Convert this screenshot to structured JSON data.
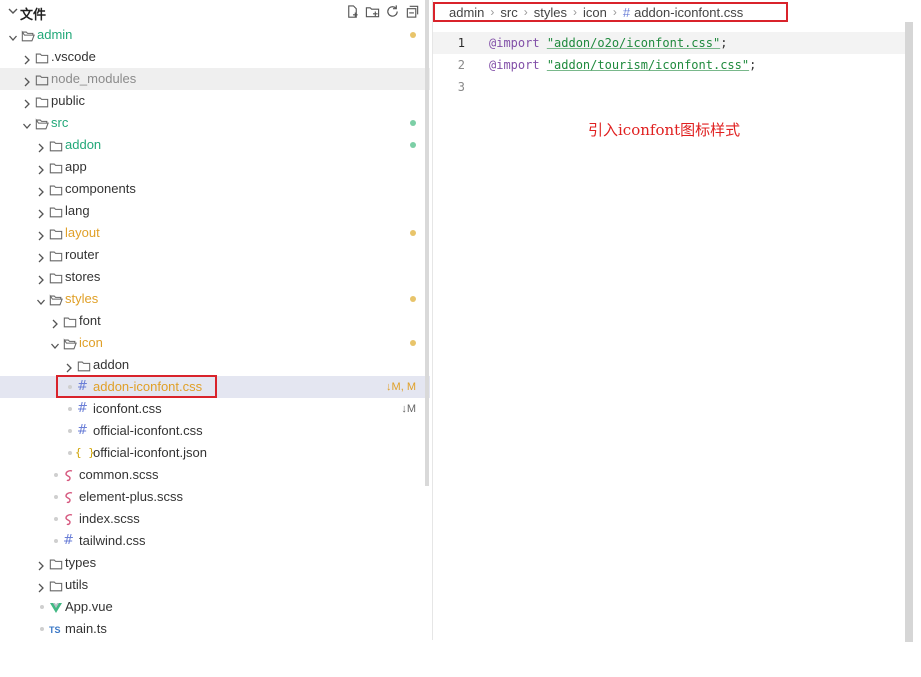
{
  "explorer": {
    "title": "文件",
    "tree": [
      {
        "id": "admin",
        "label": "admin",
        "icon": "folder-open",
        "chev": "down",
        "depth": 0,
        "color": "green",
        "dot": "#e8c46a"
      },
      {
        "id": "vscode",
        "label": ".vscode",
        "icon": "folder",
        "chev": "right",
        "depth": 1
      },
      {
        "id": "node_modules",
        "label": "node_modules",
        "icon": "folder",
        "chev": "right",
        "depth": 1,
        "dim": true
      },
      {
        "id": "public",
        "label": "public",
        "icon": "folder",
        "chev": "right",
        "depth": 1
      },
      {
        "id": "src",
        "label": "src",
        "icon": "folder-open",
        "chev": "down",
        "depth": 1,
        "color": "green",
        "dot": "#7ccfa6"
      },
      {
        "id": "addon",
        "label": "addon",
        "icon": "folder",
        "chev": "right",
        "depth": 2,
        "color": "green",
        "dot": "#7ccfa6"
      },
      {
        "id": "app",
        "label": "app",
        "icon": "folder",
        "chev": "right",
        "depth": 2
      },
      {
        "id": "components",
        "label": "components",
        "icon": "folder",
        "chev": "right",
        "depth": 2
      },
      {
        "id": "lang",
        "label": "lang",
        "icon": "folder",
        "chev": "right",
        "depth": 2
      },
      {
        "id": "layout",
        "label": "layout",
        "icon": "folder",
        "chev": "right",
        "depth": 2,
        "color": "orange",
        "dot": "#e8c46a"
      },
      {
        "id": "router",
        "label": "router",
        "icon": "folder",
        "chev": "right",
        "depth": 2
      },
      {
        "id": "stores",
        "label": "stores",
        "icon": "folder",
        "chev": "right",
        "depth": 2
      },
      {
        "id": "styles",
        "label": "styles",
        "icon": "folder-open",
        "chev": "down",
        "depth": 2,
        "color": "orange",
        "dot": "#e8c46a"
      },
      {
        "id": "font",
        "label": "font",
        "icon": "folder",
        "chev": "right",
        "depth": 3
      },
      {
        "id": "icon",
        "label": "icon",
        "icon": "folder-open",
        "chev": "down",
        "depth": 3,
        "color": "orange",
        "dot": "#e8c46a"
      },
      {
        "id": "icon_addon",
        "label": "addon",
        "icon": "folder",
        "chev": "right",
        "depth": 4
      },
      {
        "id": "addon_iconfont",
        "label": "addon-iconfont.css",
        "icon": "hash",
        "depth": 4,
        "color": "orange",
        "badge": "↓M, M",
        "selected": true
      },
      {
        "id": "iconfont",
        "label": "iconfont.css",
        "icon": "hash",
        "depth": 4,
        "badge": "↓M"
      },
      {
        "id": "official_iconfont",
        "label": "official-iconfont.css",
        "icon": "hash",
        "depth": 4
      },
      {
        "id": "official_json",
        "label": "official-iconfont.json",
        "icon": "json",
        "depth": 4
      },
      {
        "id": "common_scss",
        "label": "common.scss",
        "icon": "sass",
        "depth": 3
      },
      {
        "id": "element_scss",
        "label": "element-plus.scss",
        "icon": "sass",
        "depth": 3
      },
      {
        "id": "index_scss",
        "label": "index.scss",
        "icon": "sass",
        "depth": 3
      },
      {
        "id": "tailwind",
        "label": "tailwind.css",
        "icon": "hash",
        "depth": 3
      },
      {
        "id": "types",
        "label": "types",
        "icon": "folder",
        "chev": "right",
        "depth": 2
      },
      {
        "id": "utils",
        "label": "utils",
        "icon": "folder",
        "chev": "right",
        "depth": 2
      },
      {
        "id": "appvue",
        "label": "App.vue",
        "icon": "vue",
        "depth": 2
      },
      {
        "id": "maints",
        "label": "main.ts",
        "icon": "ts",
        "depth": 2
      }
    ]
  },
  "breadcrumb": [
    "admin",
    "src",
    "styles",
    "icon",
    "addon-iconfont.css"
  ],
  "code": {
    "lines": [
      {
        "n": "1",
        "kw": "@import",
        "str": "\"addon/o2o/iconfont.css\"",
        "end": ";"
      },
      {
        "n": "2",
        "kw": "@import",
        "str": "\"addon/tourism/iconfont.css\"",
        "end": ";"
      },
      {
        "n": "3",
        "kw": "",
        "str": "",
        "end": ""
      }
    ]
  },
  "annotation": "引入iconfont图标样式",
  "colors": {
    "green": "#23a879",
    "orange": "#e0a028",
    "highlight": "#d9232b",
    "keyword": "#8250a8",
    "string": "#1f8a3d"
  }
}
